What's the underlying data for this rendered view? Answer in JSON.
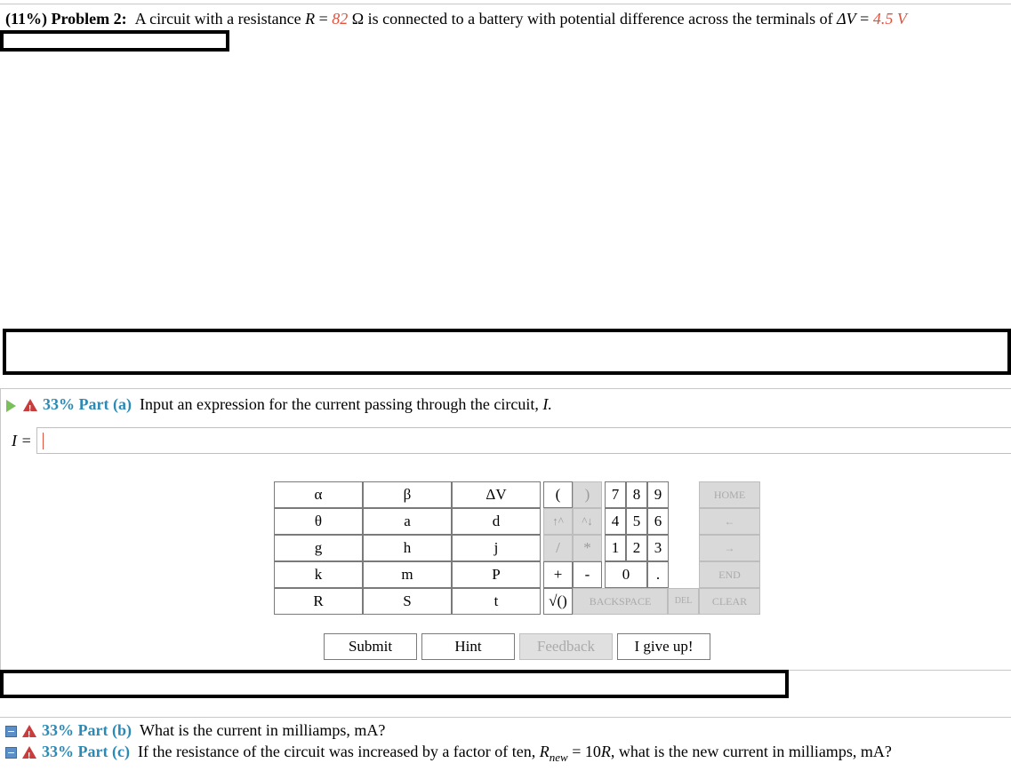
{
  "problem": {
    "percent": "(11%)",
    "title": "Problem 2:",
    "text_1": "A circuit with a resistance",
    "r_symbol": "R",
    "eq": "=",
    "r_value": "82",
    "r_unit": "Ω is connected to a battery with potential difference across the terminals of",
    "v_symbol": "ΔV",
    "v_value": "4.5 V"
  },
  "part_a": {
    "label": "33% Part (a)",
    "text": "Input an expression for the current passing through the circuit,",
    "var": "I.",
    "input_label": "I =",
    "input_value": ""
  },
  "keypad": {
    "vars": [
      [
        "α",
        "β",
        "ΔV"
      ],
      [
        "θ",
        "a",
        "d"
      ],
      [
        "g",
        "h",
        "j"
      ],
      [
        "k",
        "m",
        "P"
      ],
      [
        "R",
        "S",
        "t"
      ]
    ],
    "open_paren": "(",
    "close_paren": ")",
    "up": "↑^",
    "down": "^↓",
    "divide": "/",
    "multiply": "*",
    "plus": "+",
    "minus": "-",
    "sqrt": "√()",
    "backspace": "BACKSPACE",
    "del": "DEL",
    "clear": "CLEAR",
    "home": "HOME",
    "left": "←",
    "right": "→",
    "end": "END",
    "digits": [
      "7",
      "8",
      "9",
      "4",
      "5",
      "6",
      "1",
      "2",
      "3",
      "0",
      "."
    ]
  },
  "buttons": {
    "submit": "Submit",
    "hint": "Hint",
    "feedback": "Feedback",
    "give_up": "I give up!"
  },
  "part_b": {
    "label": "33% Part (b)",
    "text": "What is the current in milliamps, mA?"
  },
  "part_c": {
    "label": "33% Part (c)",
    "text_1": "If the resistance of the circuit was increased by a factor of ten,",
    "r_new": "R",
    "r_new_sub": "new",
    "text_2": "= 10",
    "text_3": "R",
    "text_4": ", what is the new current in milliamps, mA?"
  }
}
